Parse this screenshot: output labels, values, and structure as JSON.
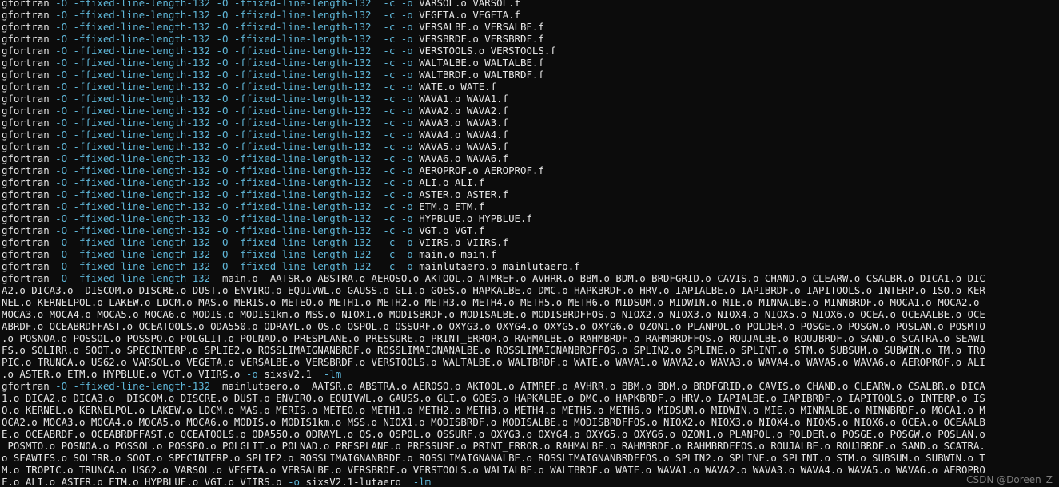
{
  "colors": {
    "background": "#0c0c0c",
    "text": "#e6e6e6",
    "flag": "#5fb7d9"
  },
  "terminal": {
    "lines": [
      [
        [
          "gfortran ",
          ""
        ],
        [
          "-O -ffixed-line-length-132 -O -ffixed-line-length-132  -c -o",
          "flag"
        ],
        [
          " VARSOL.o VARSOL.f",
          ""
        ]
      ],
      [
        [
          "gfortran ",
          ""
        ],
        [
          "-O -ffixed-line-length-132 -O -ffixed-line-length-132  -c -o",
          "flag"
        ],
        [
          " VEGETA.o VEGETA.f",
          ""
        ]
      ],
      [
        [
          "gfortran ",
          ""
        ],
        [
          "-O -ffixed-line-length-132 -O -ffixed-line-length-132  -c -o",
          "flag"
        ],
        [
          " VERSALBE.o VERSALBE.f",
          ""
        ]
      ],
      [
        [
          "gfortran ",
          ""
        ],
        [
          "-O -ffixed-line-length-132 -O -ffixed-line-length-132  -c -o",
          "flag"
        ],
        [
          " VERSBRDF.o VERSBRDF.f",
          ""
        ]
      ],
      [
        [
          "gfortran ",
          ""
        ],
        [
          "-O -ffixed-line-length-132 -O -ffixed-line-length-132  -c -o",
          "flag"
        ],
        [
          " VERSTOOLS.o VERSTOOLS.f",
          ""
        ]
      ],
      [
        [
          "gfortran ",
          ""
        ],
        [
          "-O -ffixed-line-length-132 -O -ffixed-line-length-132  -c -o",
          "flag"
        ],
        [
          " WALTALBE.o WALTALBE.f",
          ""
        ]
      ],
      [
        [
          "gfortran ",
          ""
        ],
        [
          "-O -ffixed-line-length-132 -O -ffixed-line-length-132  -c -o",
          "flag"
        ],
        [
          " WALTBRDF.o WALTBRDF.f",
          ""
        ]
      ],
      [
        [
          "gfortran ",
          ""
        ],
        [
          "-O -ffixed-line-length-132 -O -ffixed-line-length-132  -c -o",
          "flag"
        ],
        [
          " WATE.o WATE.f",
          ""
        ]
      ],
      [
        [
          "gfortran ",
          ""
        ],
        [
          "-O -ffixed-line-length-132 -O -ffixed-line-length-132  -c -o",
          "flag"
        ],
        [
          " WAVA1.o WAVA1.f",
          ""
        ]
      ],
      [
        [
          "gfortran ",
          ""
        ],
        [
          "-O -ffixed-line-length-132 -O -ffixed-line-length-132  -c -o",
          "flag"
        ],
        [
          " WAVA2.o WAVA2.f",
          ""
        ]
      ],
      [
        [
          "gfortran ",
          ""
        ],
        [
          "-O -ffixed-line-length-132 -O -ffixed-line-length-132  -c -o",
          "flag"
        ],
        [
          " WAVA3.o WAVA3.f",
          ""
        ]
      ],
      [
        [
          "gfortran ",
          ""
        ],
        [
          "-O -ffixed-line-length-132 -O -ffixed-line-length-132  -c -o",
          "flag"
        ],
        [
          " WAVA4.o WAVA4.f",
          ""
        ]
      ],
      [
        [
          "gfortran ",
          ""
        ],
        [
          "-O -ffixed-line-length-132 -O -ffixed-line-length-132  -c -o",
          "flag"
        ],
        [
          " WAVA5.o WAVA5.f",
          ""
        ]
      ],
      [
        [
          "gfortran ",
          ""
        ],
        [
          "-O -ffixed-line-length-132 -O -ffixed-line-length-132  -c -o",
          "flag"
        ],
        [
          " WAVA6.o WAVA6.f",
          ""
        ]
      ],
      [
        [
          "gfortran ",
          ""
        ],
        [
          "-O -ffixed-line-length-132 -O -ffixed-line-length-132  -c -o",
          "flag"
        ],
        [
          " AEROPROF.o AEROPROF.f",
          ""
        ]
      ],
      [
        [
          "gfortran ",
          ""
        ],
        [
          "-O -ffixed-line-length-132 -O -ffixed-line-length-132  -c -o",
          "flag"
        ],
        [
          " ALI.o ALI.f",
          ""
        ]
      ],
      [
        [
          "gfortran ",
          ""
        ],
        [
          "-O -ffixed-line-length-132 -O -ffixed-line-length-132  -c -o",
          "flag"
        ],
        [
          " ASTER.o ASTER.f",
          ""
        ]
      ],
      [
        [
          "gfortran ",
          ""
        ],
        [
          "-O -ffixed-line-length-132 -O -ffixed-line-length-132  -c -o",
          "flag"
        ],
        [
          " ETM.o ETM.f",
          ""
        ]
      ],
      [
        [
          "gfortran ",
          ""
        ],
        [
          "-O -ffixed-line-length-132 -O -ffixed-line-length-132  -c -o",
          "flag"
        ],
        [
          " HYPBLUE.o HYPBLUE.f",
          ""
        ]
      ],
      [
        [
          "gfortran ",
          ""
        ],
        [
          "-O -ffixed-line-length-132 -O -ffixed-line-length-132  -c -o",
          "flag"
        ],
        [
          " VGT.o VGT.f",
          ""
        ]
      ],
      [
        [
          "gfortran ",
          ""
        ],
        [
          "-O -ffixed-line-length-132 -O -ffixed-line-length-132  -c -o",
          "flag"
        ],
        [
          " VIIRS.o VIIRS.f",
          ""
        ]
      ],
      [
        [
          "gfortran ",
          ""
        ],
        [
          "-O -ffixed-line-length-132 -O -ffixed-line-length-132  -c -o",
          "flag"
        ],
        [
          " main.o main.f",
          ""
        ]
      ],
      [
        [
          "gfortran ",
          ""
        ],
        [
          "-O -ffixed-line-length-132 -O -ffixed-line-length-132  -c -o",
          "flag"
        ],
        [
          " mainlutaero.o mainlutaero.f",
          ""
        ]
      ],
      [
        [
          "gfortran ",
          ""
        ],
        [
          "-O -ffixed-line-length-132",
          "flag"
        ],
        [
          "  main.o  AATSR.o ABSTRA.o AEROSO.o AKTOOL.o ATMREF.o AVHRR.o BBM.o BDM.o BRDFGRID.o CAVIS.o CHAND.o CLEARW.o CSALBR.o DICA1.o DIC",
          ""
        ]
      ],
      [
        [
          "A2.o DICA3.o  DISCOM.o DISCRE.o DUST.o ENVIRO.o EQUIVWL.o GAUSS.o GLI.o GOES.o HAPKALBE.o DMC.o HAPKBRDF.o HRV.o IAPIALBE.o IAPIBRDF.o IAPITOOLS.o INTERP.o ISO.o KER",
          ""
        ]
      ],
      [
        [
          "NEL.o KERNELPOL.o LAKEW.o LDCM.o MAS.o MERIS.o METEO.o METH1.o METH2.o METH3.o METH4.o METH5.o METH6.o MIDSUM.o MIDWIN.o MIE.o MINNALBE.o MINNBRDF.o MOCA1.o MOCA2.o",
          ""
        ]
      ],
      [
        [
          "MOCA3.o MOCA4.o MOCA5.o MOCA6.o MODIS.o MODIS1km.o MSS.o NIOX1.o MODISBRDF.o MODISALBE.o MODISBRDFFOS.o NIOX2.o NIOX3.o NIOX4.o NIOX5.o NIOX6.o OCEA.o OCEAALBE.o OCE",
          ""
        ]
      ],
      [
        [
          "ABRDF.o OCEABRDFFAST.o OCEATOOLS.o ODA550.o ODRAYL.o OS.o OSPOL.o OSSURF.o OXYG3.o OXYG4.o OXYG5.o OXYG6.o OZON1.o PLANPOL.o POLDER.o POSGE.o POSGW.o POSLAN.o POSMTO",
          ""
        ]
      ],
      [
        [
          ".o POSNOA.o POSSOL.o POSSPO.o POLGLIT.o POLNAD.o PRESPLANE.o PRESSURE.o PRINT_ERROR.o RAHMALBE.o RAHMBRDF.o RAHMBRDFFOS.o ROUJALBE.o ROUJBRDF.o SAND.o SCATRA.o SEAWI",
          ""
        ]
      ],
      [
        [
          "FS.o SOLIRR.o SOOT.o SPECINTERP.o SPLIE2.o ROSSLIMAIGNANBRDF.o ROSSLIMAIGNANALBE.o ROSSLIMAIGNANBRDFFOS.o SPLIN2.o SPLINE.o SPLINT.o STM.o SUBSUM.o SUBWIN.o TM.o TRO",
          ""
        ]
      ],
      [
        [
          "PIC.o TRUNCA.o US62.o VARSOL.o VEGETA.o VERSALBE.o VERSBRDF.o VERSTOOLS.o WALTALBE.o WALTBRDF.o WATE.o WAVA1.o WAVA2.o WAVA3.o WAVA4.o WAVA5.o WAVA6.o AEROPROF.o ALI",
          ""
        ]
      ],
      [
        [
          ".o ASTER.o ETM.o HYPBLUE.o VGT.o VIIRS.o ",
          ""
        ],
        [
          "-o",
          "flag"
        ],
        [
          " sixsV2.1  ",
          ""
        ],
        [
          "-lm",
          "flag"
        ]
      ],
      [
        [
          "gfortran ",
          ""
        ],
        [
          "-O -ffixed-line-length-132",
          "flag"
        ],
        [
          "  mainlutaero.o  AATSR.o ABSTRA.o AEROSO.o AKTOOL.o ATMREF.o AVHRR.o BBM.o BDM.o BRDFGRID.o CAVIS.o CHAND.o CLEARW.o CSALBR.o DICA",
          ""
        ]
      ],
      [
        [
          "1.o DICA2.o DICA3.o  DISCOM.o DISCRE.o DUST.o ENVIRO.o EQUIVWL.o GAUSS.o GLI.o GOES.o HAPKALBE.o DMC.o HAPKBRDF.o HRV.o IAPIALBE.o IAPIBRDF.o IAPITOOLS.o INTERP.o IS",
          ""
        ]
      ],
      [
        [
          "O.o KERNEL.o KERNELPOL.o LAKEW.o LDCM.o MAS.o MERIS.o METEO.o METH1.o METH2.o METH3.o METH4.o METH5.o METH6.o MIDSUM.o MIDWIN.o MIE.o MINNALBE.o MINNBRDF.o MOCA1.o M",
          ""
        ]
      ],
      [
        [
          "OCA2.o MOCA3.o MOCA4.o MOCA5.o MOCA6.o MODIS.o MODIS1km.o MSS.o NIOX1.o MODISBRDF.o MODISALBE.o MODISBRDFFOS.o NIOX2.o NIOX3.o NIOX4.o NIOX5.o NIOX6.o OCEA.o OCEAALB",
          ""
        ]
      ],
      [
        [
          "E.o OCEABRDF.o OCEABRDFFAST.o OCEATOOLS.o ODA550.o ODRAYL.o OS.o OSPOL.o OSSURF.o OXYG3.o OXYG4.o OXYG5.o OXYG6.o OZON1.o PLANPOL.o POLDER.o POSGE.o POSGW.o POSLAN.o",
          ""
        ]
      ],
      [
        [
          " POSMTO.o POSNOA.o POSSOL.o POSSPO.o POLGLIT.o POLNAD.o PRESPLANE.o PRESSURE.o PRINT_ERROR.o RAHMALBE.o RAHMBRDF.o RAHMBRDFFOS.o ROUJALBE.o ROUJBRDF.o SAND.o SCATRA.",
          ""
        ]
      ],
      [
        [
          "o SEAWIFS.o SOLIRR.o SOOT.o SPECINTERP.o SPLIE2.o ROSSLIMAIGNANBRDF.o ROSSLIMAIGNANALBE.o ROSSLIMAIGNANBRDFFOS.o SPLIN2.o SPLINE.o SPLINT.o STM.o SUBSUM.o SUBWIN.o T",
          ""
        ]
      ],
      [
        [
          "M.o TROPIC.o TRUNCA.o US62.o VARSOL.o VEGETA.o VERSALBE.o VERSBRDF.o VERSTOOLS.o WALTALBE.o WALTBRDF.o WATE.o WAVA1.o WAVA2.o WAVA3.o WAVA4.o WAVA5.o WAVA6.o AEROPRO",
          ""
        ]
      ],
      [
        [
          "F.o ALI.o ASTER.o ETM.o HYPBLUE.o VGT.o VIIRS.o ",
          ""
        ],
        [
          "-o",
          "flag"
        ],
        [
          " sixsV2.1-lutaero  ",
          ""
        ],
        [
          "-lm",
          "flag"
        ]
      ]
    ]
  },
  "watermark": "CSDN @Doreen_Z"
}
